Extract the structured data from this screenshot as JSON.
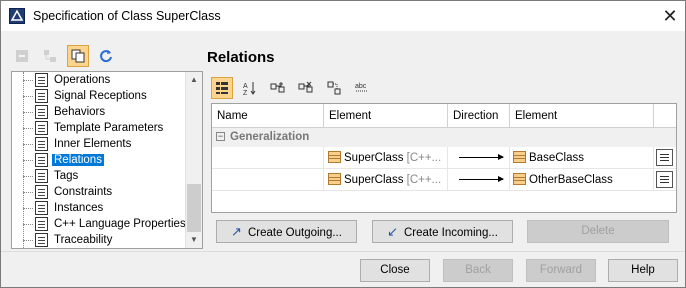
{
  "window": {
    "title": "Specification of Class SuperClass",
    "close_glyph": "✕"
  },
  "left_toolbar": [
    {
      "icon": "collapse-tree-icon",
      "state": "disabled"
    },
    {
      "icon": "expand-tree-icon",
      "state": "disabled"
    },
    {
      "icon": "copy-view-icon",
      "state": "active"
    },
    {
      "icon": "refresh-icon",
      "state": "normal"
    }
  ],
  "tree": {
    "items": [
      "Operations",
      "Signal Receptions",
      "Behaviors",
      "Template Parameters",
      "Inner Elements",
      "Relations",
      "Tags",
      "Constraints",
      "Instances",
      "C++ Language Properties",
      "Traceability"
    ],
    "selected": "Relations"
  },
  "relations": {
    "title": "Relations",
    "toolbar": [
      "group-by-icon",
      "sort-alpha-icon",
      "add-relation-icon",
      "remove-relation-icon",
      "layout-icon",
      "abc-filter-icon"
    ],
    "columns": [
      "Name",
      "Element",
      "Direction",
      "Element"
    ],
    "group": {
      "toggle": "−",
      "label": "Generalization"
    },
    "rows": [
      {
        "name": "",
        "source": "SuperClass",
        "source_suffix": "[C++...",
        "target": "BaseClass"
      },
      {
        "name": "",
        "source": "SuperClass",
        "source_suffix": "[C++...",
        "target": "OtherBaseClass"
      }
    ]
  },
  "actions": {
    "create_outgoing": "Create Outgoing...",
    "create_incoming": "Create Incoming...",
    "delete": "Delete"
  },
  "footer": {
    "close": "Close",
    "back": "Back",
    "forward": "Forward",
    "help": "Help"
  }
}
